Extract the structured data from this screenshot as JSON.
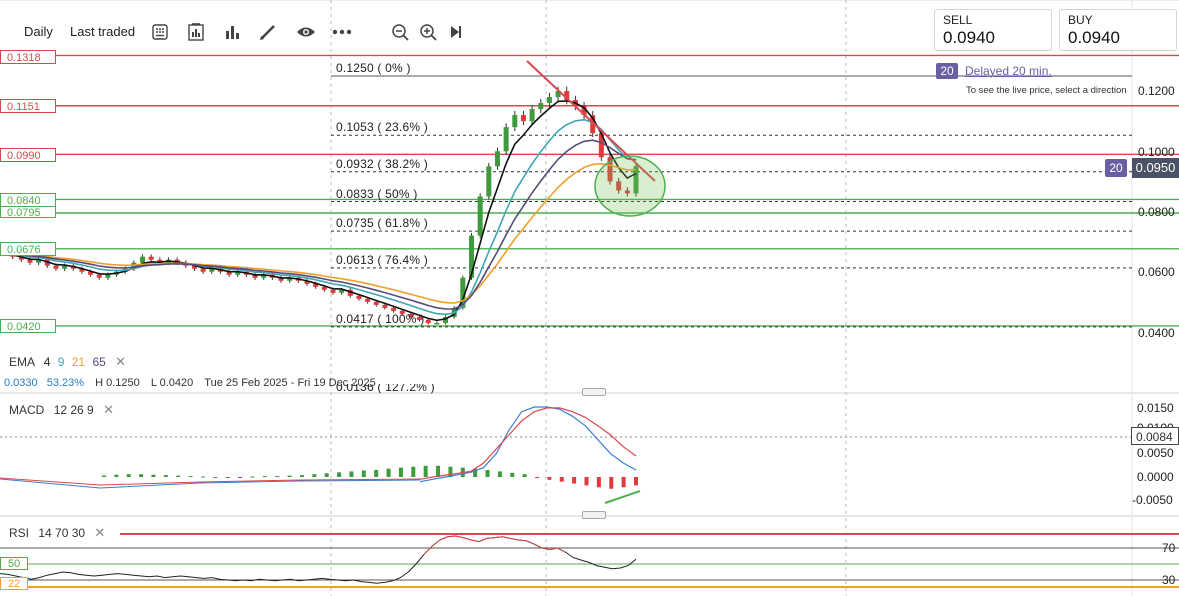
{
  "toolbar": {
    "interval": "Daily",
    "price_mode": "Last traded"
  },
  "trade": {
    "sell_label": "SELL",
    "sell_price": "0.0940",
    "buy_label": "BUY",
    "buy_price": "0.0940",
    "delay_badge": "20",
    "delay_text": "Delayed 20 min.",
    "hint": "To see the live price, select a direction"
  },
  "levels": {
    "left_tags": [
      "0.1318",
      "0.1151",
      "0.0990",
      "0.0840",
      "0.0795",
      "0.0676",
      "0.0420"
    ],
    "red_levels": [
      0.1318,
      0.1151,
      0.099
    ],
    "green_levels": [
      0.084,
      0.0795,
      0.0676,
      0.042
    ]
  },
  "fib": {
    "labels": [
      "0.1250 ( 0% )",
      "0.1053 ( 23.6% )",
      "0.0932 ( 38.2% )",
      "0.0833 ( 50% )",
      "0.0735 ( 61.8% )",
      "0.0613 ( 76.4% )",
      "0.0417 ( 100% )",
      "0.0136 ( 127.2% )"
    ],
    "values": [
      0.125,
      0.1053,
      0.0932,
      0.0833,
      0.0735,
      0.0613,
      0.0417,
      0.0136
    ]
  },
  "price_axis": {
    "ticks": [
      "0.1200",
      "0.1000",
      "0.0800",
      "0.0600",
      "0.0400"
    ],
    "last_badge": "20",
    "last_price": "0.0950"
  },
  "legend": {
    "ema_label": "EMA",
    "ema_periods": [
      "4",
      "9",
      "21",
      "65"
    ],
    "stats": {
      "change": "0.0330",
      "change_pct": "53.23%",
      "high": "H 0.1250",
      "low": "L 0.0420",
      "range": "Tue 25 Feb 2025 - Fri 19 Dec 2025"
    }
  },
  "macd": {
    "label": "MACD",
    "params": "12  26  9",
    "ticks": [
      "0.0150",
      "0.0100",
      "0.0050",
      "0.0000",
      "-0.0050"
    ],
    "current": "0.0084"
  },
  "rsi": {
    "label": "RSI",
    "params": "14  70  30",
    "ticks": [
      "70",
      "30"
    ],
    "left_tags": [
      "50",
      "22"
    ]
  },
  "colors": {
    "red_line": "#d9484d",
    "green_line": "#4caf50",
    "ema4": "#111111",
    "ema9": "#3fa6b5",
    "ema21": "#f0a028",
    "ema65": "#5a4a7a",
    "up_candle": "#3d9b3d",
    "down_candle": "#e03a3a",
    "accent": "#6b5fa3"
  },
  "chart_data": [
    {
      "type": "line",
      "subtype": "candlestick",
      "x_range": [
        "25 Feb 2025",
        "19 Dec 2025"
      ],
      "ylim": [
        0.035,
        0.135
      ],
      "series": [
        {
          "name": "price_close",
          "values": [
            0.066,
            0.065,
            0.064,
            0.063,
            0.064,
            0.062,
            0.061,
            0.062,
            0.061,
            0.06,
            0.059,
            0.058,
            0.059,
            0.06,
            0.061,
            0.063,
            0.065,
            0.064,
            0.063,
            0.064,
            0.063,
            0.062,
            0.061,
            0.06,
            0.061,
            0.06,
            0.059,
            0.06,
            0.059,
            0.058,
            0.059,
            0.058,
            0.057,
            0.058,
            0.057,
            0.056,
            0.055,
            0.054,
            0.053,
            0.054,
            0.052,
            0.051,
            0.05,
            0.049,
            0.048,
            0.047,
            0.046,
            0.045,
            0.044,
            0.043,
            0.043,
            0.045,
            0.048,
            0.058,
            0.072,
            0.085,
            0.095,
            0.1,
            0.108,
            0.112,
            0.11,
            0.114,
            0.116,
            0.118,
            0.12,
            0.117,
            0.115,
            0.112,
            0.106,
            0.098,
            0.09,
            0.087,
            0.086,
            0.095
          ]
        },
        {
          "name": "EMA 4",
          "values": []
        },
        {
          "name": "EMA 9",
          "values": []
        },
        {
          "name": "EMA 21",
          "values": []
        },
        {
          "name": "EMA 65",
          "values": []
        }
      ]
    },
    {
      "type": "bar",
      "name": "MACD",
      "ylim": [
        -0.008,
        0.017
      ],
      "histogram": [
        0.0003,
        0.0005,
        0.0006,
        0.0006,
        0.0005,
        0.0004,
        0.0003,
        0.0002,
        0.0001,
        0.0,
        -0.0001,
        -0.0001,
        0.0001,
        0.0002,
        0.0002,
        0.0003,
        0.0004,
        0.0006,
        0.0008,
        0.001,
        0.0012,
        0.0014,
        0.0015,
        0.0018,
        0.002,
        0.0022,
        0.0024,
        0.0024,
        0.0022,
        0.002,
        0.0018,
        0.0015,
        0.0012,
        0.0009,
        0.0006,
        -0.0002,
        -0.0006,
        -0.001,
        -0.0014,
        -0.0018,
        -0.0022,
        -0.0025,
        -0.0022,
        -0.0018
      ],
      "macd_line": [
        -0.001,
        -0.0005,
        0.0,
        0.0005,
        0.001,
        0.002,
        0.005,
        0.01,
        0.014,
        0.015,
        0.015,
        0.0145,
        0.013,
        0.011,
        0.008,
        0.005,
        0.003,
        0.0015
      ],
      "signal_line": [
        -0.0005,
        0.0,
        0.0004,
        0.0008,
        0.0012,
        0.003,
        0.006,
        0.009,
        0.012,
        0.014,
        0.0148,
        0.0148,
        0.014,
        0.0128,
        0.011,
        0.009,
        0.0065,
        0.0045
      ]
    },
    {
      "type": "line",
      "name": "RSI",
      "ylim": [
        20,
        90
      ],
      "levels": [
        70,
        50,
        30
      ],
      "values": [
        38,
        37,
        35,
        33,
        31,
        33,
        36,
        38,
        40,
        39,
        37,
        36,
        35,
        36,
        37,
        38,
        37,
        36,
        35,
        34,
        35,
        33,
        34,
        35,
        34,
        33,
        32,
        33,
        31,
        30,
        29,
        30,
        29,
        31,
        30,
        29,
        30,
        31,
        29,
        30,
        31,
        32,
        31,
        30,
        29,
        30,
        28,
        27,
        26,
        27,
        29,
        33,
        40,
        50,
        62,
        72,
        80,
        84,
        85,
        83,
        80,
        78,
        82,
        83,
        84,
        82,
        80,
        79,
        75,
        70,
        68,
        70,
        65,
        58,
        55,
        52,
        48,
        46,
        44,
        45,
        48,
        56
      ]
    }
  ]
}
